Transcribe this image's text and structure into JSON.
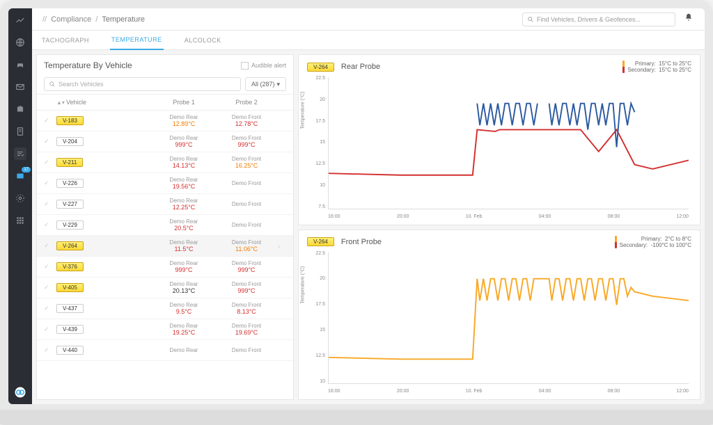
{
  "breadcrumb": {
    "sep": "//",
    "l1": "Compliance",
    "l2": "Temperature"
  },
  "search_placeholder": "Find Vehicles, Drivers & Geofences...",
  "tabs": {
    "tachograph": "TACHOGRAPH",
    "temperature": "TEMPERATURE",
    "alcolock": "ALCOLOCK"
  },
  "panel": {
    "title": "Temperature By Vehicle",
    "audible": "Audible alert",
    "search_placeholder": "Search Vehicles",
    "filter_label": "All (287)"
  },
  "columns": {
    "vehicle": "Vehicle",
    "probe1": "Probe 1",
    "probe2": "Probe 2"
  },
  "rows": [
    {
      "id": "V-183",
      "hl": true,
      "p1n": "Demo Rear",
      "p1v": "12.89°C",
      "p1c": "val-orange",
      "p2n": "Demo Front",
      "p2v": "12.78°C",
      "p2c": "val-red"
    },
    {
      "id": "V-204",
      "hl": false,
      "p1n": "Demo Rear",
      "p1v": "999°C",
      "p1c": "val-red",
      "p2n": "Demo Front",
      "p2v": "999°C",
      "p2c": "val-red"
    },
    {
      "id": "V-211",
      "hl": true,
      "p1n": "Demo Rear",
      "p1v": "14.13°C",
      "p1c": "val-red",
      "p2n": "Demo Front",
      "p2v": "16.25°C",
      "p2c": "val-orange"
    },
    {
      "id": "V-226",
      "hl": false,
      "p1n": "Demo Rear",
      "p1v": "19.56°C",
      "p1c": "val-red",
      "p2n": "Demo Front",
      "p2v": "",
      "p2c": "val-normal"
    },
    {
      "id": "V-227",
      "hl": false,
      "p1n": "Demo Rear",
      "p1v": "12.25°C",
      "p1c": "val-red",
      "p2n": "Demo Front",
      "p2v": "",
      "p2c": "val-normal"
    },
    {
      "id": "V-229",
      "hl": false,
      "p1n": "Demo Rear",
      "p1v": "20.5°C",
      "p1c": "val-red",
      "p2n": "Demo Front",
      "p2v": "",
      "p2c": "val-normal"
    },
    {
      "id": "V-264",
      "hl": true,
      "sel": true,
      "p1n": "Demo Rear",
      "p1v": "11.5°C",
      "p1c": "val-red",
      "p2n": "Demo Front",
      "p2v": "11.06°C",
      "p2c": "val-orange"
    },
    {
      "id": "V-376",
      "hl": true,
      "p1n": "Demo Rear",
      "p1v": "999°C",
      "p1c": "val-red",
      "p2n": "Demo Front",
      "p2v": "999°C",
      "p2c": "val-red"
    },
    {
      "id": "V-405",
      "hl": true,
      "p1n": "Demo Rear",
      "p1v": "20.13°C",
      "p1c": "val-normal",
      "p2n": "Demo Front",
      "p2v": "999°C",
      "p2c": "val-red"
    },
    {
      "id": "V-437",
      "hl": false,
      "p1n": "Demo Rear",
      "p1v": "9.5°C",
      "p1c": "val-red",
      "p2n": "Demo Front",
      "p2v": "8.13°C",
      "p2c": "val-red"
    },
    {
      "id": "V-439",
      "hl": false,
      "p1n": "Demo Rear",
      "p1v": "19.25°C",
      "p1c": "val-red",
      "p2n": "Demo Front",
      "p2v": "19.69°C",
      "p2c": "val-red"
    },
    {
      "id": "V-440",
      "hl": false,
      "p1n": "Demo Rear",
      "p1v": "",
      "p1c": "val-normal",
      "p2n": "Demo Front",
      "p2v": "",
      "p2c": "val-normal"
    }
  ],
  "chart1": {
    "tag": "V-264",
    "title": "Rear Probe",
    "legend": {
      "primary_label": "Primary:",
      "primary_val": "15°C to 25°C",
      "secondary_label": "Secondary:",
      "secondary_val": "15°C to 25°C"
    },
    "ylabel": "Temperature (°C)",
    "yticks": [
      "22.5",
      "20",
      "17.5",
      "15",
      "12.5",
      "10",
      "7.5"
    ],
    "xticks": [
      "16:00",
      "20:00",
      "10. Feb",
      "04:00",
      "08:00",
      "12:00"
    ]
  },
  "chart2": {
    "tag": "V-264",
    "title": "Front Probe",
    "legend": {
      "primary_label": "Primary:",
      "primary_val": "2°C to 8°C",
      "secondary_label": "Secondary:",
      "secondary_val": "-100°C to 100°C"
    },
    "ylabel": "Temperature (°C)",
    "yticks": [
      "22.5",
      "20",
      "17.5",
      "15",
      "12.5",
      "10"
    ],
    "xticks": [
      "16:00",
      "20:00",
      "10. Feb",
      "04:00",
      "08:00",
      "12:00"
    ]
  },
  "chart_data": [
    {
      "type": "line",
      "title": "Rear Probe",
      "ylabel": "Temperature (°C)",
      "ylim": [
        7.5,
        22.5
      ],
      "x": [
        "16:00",
        "20:00",
        "10. Feb",
        "04:00",
        "08:00",
        "12:00"
      ],
      "series": [
        {
          "name": "Primary",
          "color": "#2c5aa0",
          "values": [
            null,
            null,
            null,
            20,
            20,
            19
          ]
        },
        {
          "name": "Secondary",
          "color": "#d32f2f",
          "values": [
            11.5,
            11.4,
            11.4,
            15,
            15,
            12.5
          ]
        }
      ]
    },
    {
      "type": "line",
      "title": "Front Probe",
      "ylabel": "Temperature (°C)",
      "ylim": [
        10,
        22.5
      ],
      "x": [
        "16:00",
        "20:00",
        "10. Feb",
        "04:00",
        "08:00",
        "12:00"
      ],
      "series": [
        {
          "name": "Primary",
          "color": "#f9a825",
          "values": [
            11,
            11,
            11,
            20,
            20,
            19
          ]
        }
      ]
    }
  ]
}
